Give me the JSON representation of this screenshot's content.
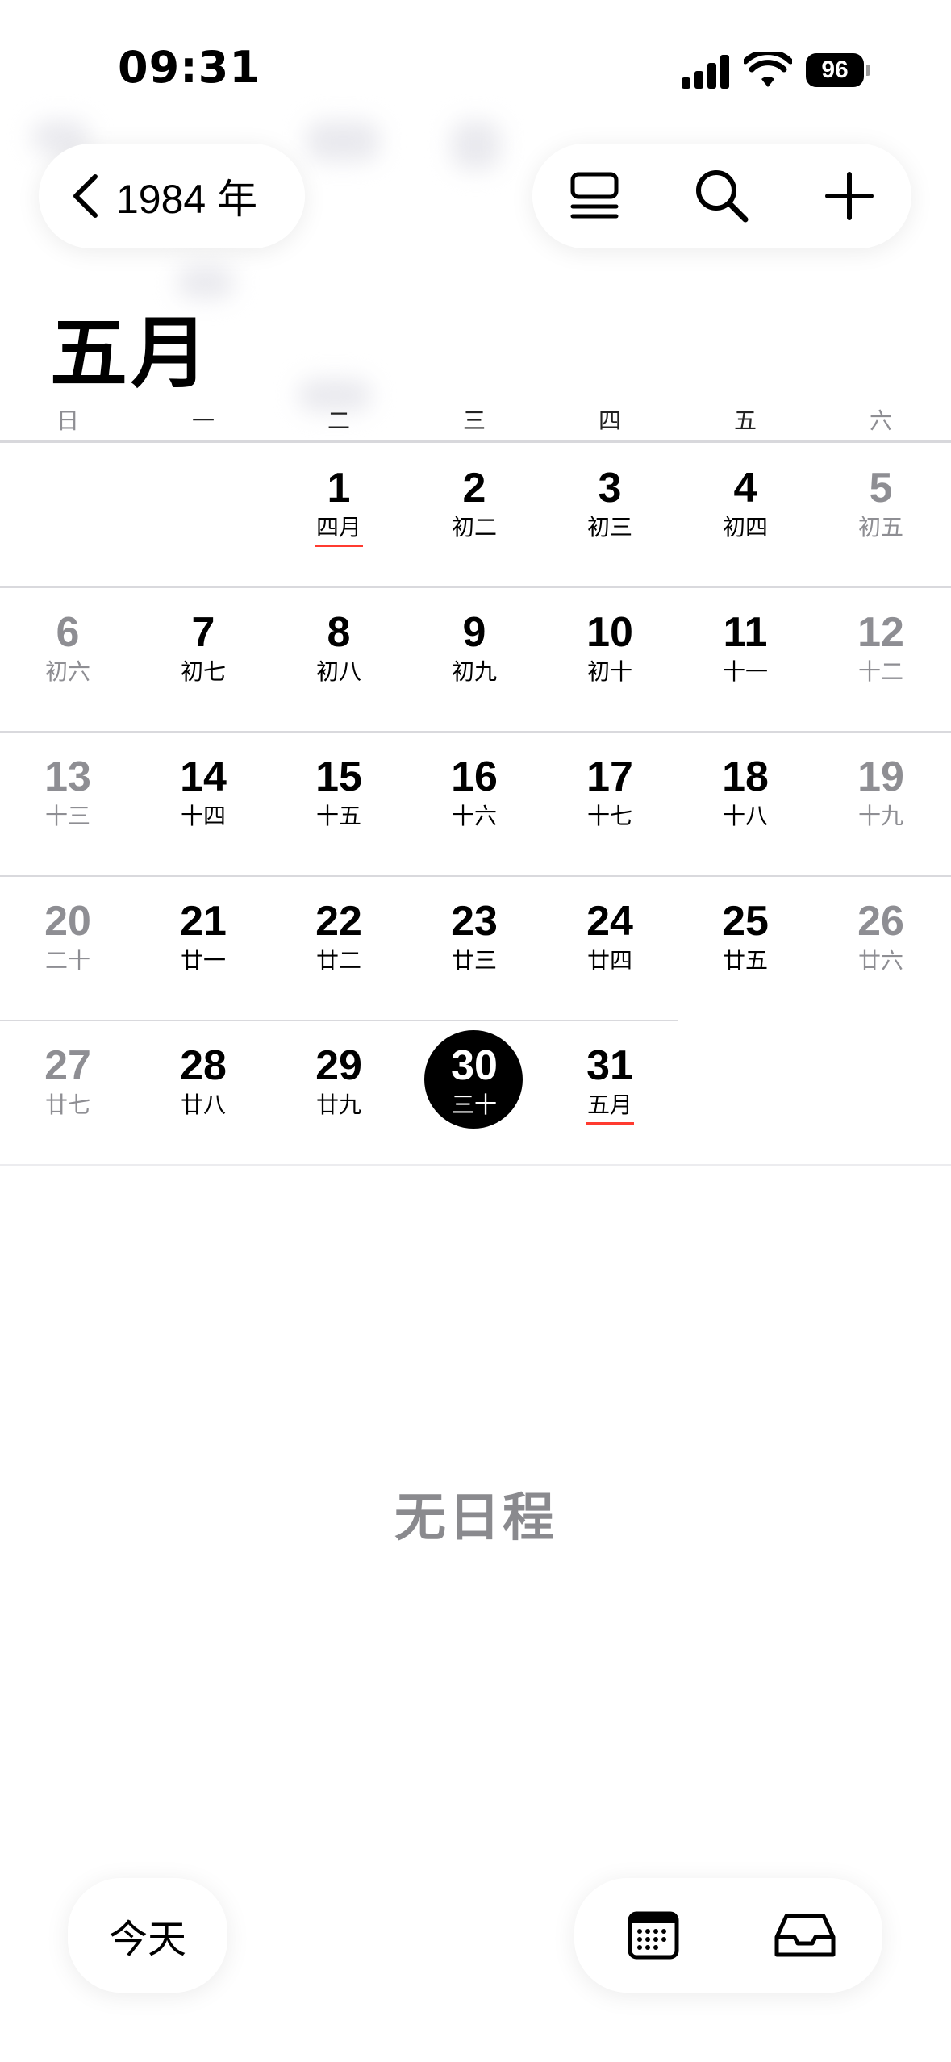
{
  "status": {
    "time": "09:31",
    "battery": "96"
  },
  "toolbar": {
    "back_label": "1984 年"
  },
  "month": {
    "title": "五月"
  },
  "weekdays": [
    "日",
    "一",
    "二",
    "三",
    "四",
    "五",
    "六"
  ],
  "weeks": [
    [
      null,
      null,
      {
        "day": "1",
        "lunar": "四月",
        "marked": true
      },
      {
        "day": "2",
        "lunar": "初二"
      },
      {
        "day": "3",
        "lunar": "初三"
      },
      {
        "day": "4",
        "lunar": "初四"
      },
      {
        "day": "5",
        "lunar": "初五"
      }
    ],
    [
      {
        "day": "6",
        "lunar": "初六"
      },
      {
        "day": "7",
        "lunar": "初七"
      },
      {
        "day": "8",
        "lunar": "初八"
      },
      {
        "day": "9",
        "lunar": "初九"
      },
      {
        "day": "10",
        "lunar": "初十"
      },
      {
        "day": "11",
        "lunar": "十一"
      },
      {
        "day": "12",
        "lunar": "十二"
      }
    ],
    [
      {
        "day": "13",
        "lunar": "十三"
      },
      {
        "day": "14",
        "lunar": "十四"
      },
      {
        "day": "15",
        "lunar": "十五"
      },
      {
        "day": "16",
        "lunar": "十六"
      },
      {
        "day": "17",
        "lunar": "十七"
      },
      {
        "day": "18",
        "lunar": "十八"
      },
      {
        "day": "19",
        "lunar": "十九"
      }
    ],
    [
      {
        "day": "20",
        "lunar": "二十"
      },
      {
        "day": "21",
        "lunar": "廿一"
      },
      {
        "day": "22",
        "lunar": "廿二"
      },
      {
        "day": "23",
        "lunar": "廿三"
      },
      {
        "day": "24",
        "lunar": "廿四"
      },
      {
        "day": "25",
        "lunar": "廿五"
      },
      {
        "day": "26",
        "lunar": "廿六"
      }
    ],
    [
      {
        "day": "27",
        "lunar": "廿七"
      },
      {
        "day": "28",
        "lunar": "廿八"
      },
      {
        "day": "29",
        "lunar": "廿九"
      },
      {
        "day": "30",
        "lunar": "三十",
        "today": true
      },
      {
        "day": "31",
        "lunar": "五月",
        "marked": true
      },
      null,
      null
    ]
  ],
  "empty_state": "无日程",
  "bottom": {
    "today_label": "今天"
  },
  "icons": {
    "back": "chevron-left-icon",
    "list_view": "list-view-icon",
    "search": "search-icon",
    "add": "plus-icon",
    "calendars": "calendar-grid-icon",
    "inbox": "inbox-tray-icon"
  },
  "colors": {
    "accent_today": "#000000",
    "month_start_marker": "#ff3b30",
    "muted": "#8e8e93"
  }
}
